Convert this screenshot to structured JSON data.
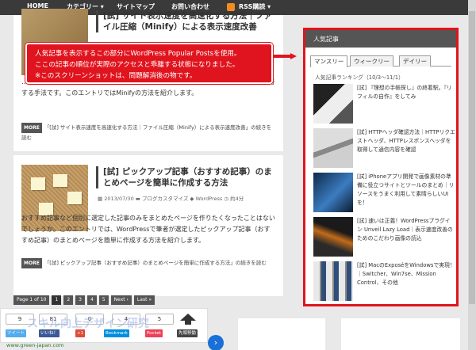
{
  "nav": {
    "items": [
      "HOME",
      "カテゴリー ▾",
      "サイトマップ",
      "お問い合わせ",
      "RSS購読 ▾"
    ]
  },
  "posts": [
    {
      "title": "[試] サイト表示速度を高速化する方法｜ファイル圧縮（Minify）による表示速度改善",
      "excerpt": "…空白、改行、コメントを削減して、ダウンロード時間を短縮し、サイト表示速度を改善する手法です。このエントリではMinifyの方法を紹介します。",
      "more_badge": "MORE",
      "more_text": "「[試] サイト表示速度を高速化する方法｜ファイル圧縮（Minify）による表示速度改善」の続きを読む"
    },
    {
      "title": "[試] ピックアップ記事（おすすめ記事）のまとめページを簡単に作成する方法",
      "date": "2013/07/30",
      "category": "ブログカスタマイズ",
      "tag": "WordPress",
      "reading_time": "約4分",
      "excerpt": "おすすめ記事など個別に選定した記事のみをまとめたページを作りたくなったことはないでしょうか。このエントリでは、WordPressで筆者が選定したピックアップ記事（おすすめ記事）のまとめページを簡単に作成する方法を紹介します。",
      "more_badge": "MORE",
      "more_text": "「[試] ピックアップ記事（おすすめ記事）のまとめページを簡単に作成する方法」の続きを読む"
    }
  ],
  "pager": [
    "Page 1 of 10",
    "1",
    "2",
    "3",
    "4",
    "5",
    "Next ›",
    "Last »"
  ],
  "callout": {
    "lines": [
      "人気記事を表示するこの部分にWordPress Popular Postsを使用。",
      "ここの記事の順位が実際のアクセスと乖離する状態になりました。",
      "※このスクリーンショットは、問題解消後の物です。"
    ]
  },
  "sidebar": {
    "heading": "人気記事",
    "tabs": [
      "マンスリー",
      "ウィークリー",
      "デイリー"
    ],
    "ranking_heading": "人気記事ランキング（10/3〜11/1）",
    "items": [
      {
        "title": "[試] 『理想の手帳探し』の終着駅。『リフィルの自作』をしてみ"
      },
      {
        "title": "[試] HTTPヘッダ確認方法｜HTTPリクエストヘッダ、HTTPレスポンスヘッダを取得して通信内容を確認"
      },
      {
        "title": "[試] iPhoneアプリ開発で画像素材の準備に役立つサイトとツールのまとめ｜リソースをうまく利用して素晴らしいUIを！"
      },
      {
        "title": "[試] 速いは正義！WordPressプラグイン Unveil Lazy Load｜表示速度改善のためのこだわり画像の読込"
      },
      {
        "title": "[試] MacのExposéをWindowsで実現！｜Switcher、Win7se、Mission Control、その他"
      }
    ]
  },
  "social": {
    "counts": [
      "9",
      "81",
      "0",
      "4",
      "5"
    ],
    "buttons": [
      "ツイート",
      "いいね！",
      "+1",
      "Bookmark",
      "Pocket",
      "先頭移動"
    ]
  },
  "footer": {
    "ghost_text": "スキル向上デザイン研究",
    "domain": "www.green-japan.com"
  },
  "colors": {
    "accent_red": "#e0141e",
    "nav_bg": "#3a3a3a"
  }
}
